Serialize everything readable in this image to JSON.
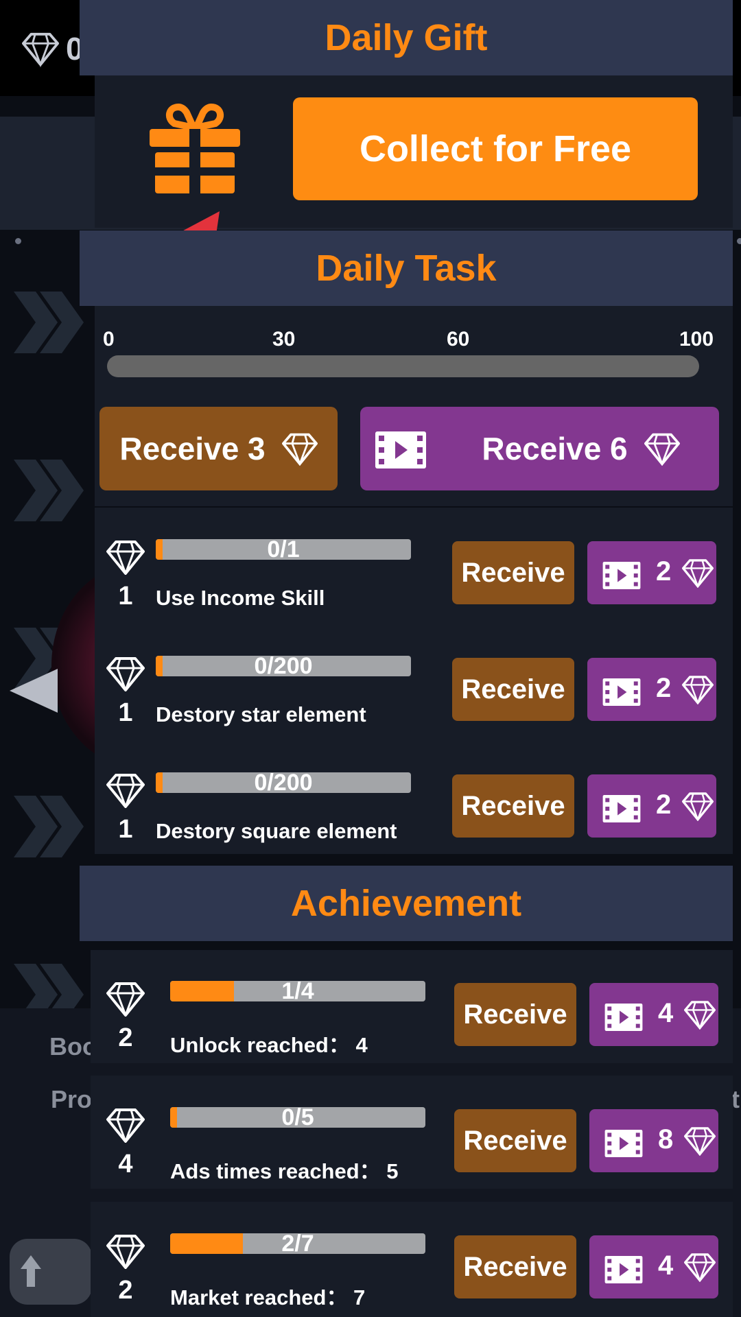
{
  "background": {
    "gem_count": "0",
    "label_1": "Boo",
    "label_2": "Pro",
    "label_3": "t"
  },
  "daily_gift": {
    "title": "Daily Gift",
    "collect_label": "Collect for Free"
  },
  "daily_task": {
    "title": "Daily Task",
    "progress_ticks": [
      "0",
      "30",
      "60",
      "100"
    ],
    "progress_value": 0,
    "receive_label": "Receive 3",
    "receive_ad_label": "Receive 6",
    "tasks": [
      {
        "reward": "1",
        "progress": "0/1",
        "fraction": 0,
        "label": "Use Income Skill",
        "receive": "Receive",
        "ad_reward": "2"
      },
      {
        "reward": "1",
        "progress": "0/200",
        "fraction": 0,
        "label": "Destory star element",
        "receive": "Receive",
        "ad_reward": "2"
      },
      {
        "reward": "1",
        "progress": "0/200",
        "fraction": 0,
        "label": "Destory square element",
        "receive": "Receive",
        "ad_reward": "2"
      }
    ]
  },
  "achievement": {
    "title": "Achievement",
    "items": [
      {
        "reward": "2",
        "progress": "1/4",
        "fraction": 0.25,
        "label": "Unlock reached： 4",
        "receive": "Receive",
        "ad_reward": "4"
      },
      {
        "reward": "4",
        "progress": "0/5",
        "fraction": 0,
        "label": "Ads times reached： 5",
        "receive": "Receive",
        "ad_reward": "8"
      },
      {
        "reward": "2",
        "progress": "2/7",
        "fraction": 0.2857,
        "label": "Market reached： 7",
        "receive": "Receive",
        "ad_reward": "4"
      }
    ]
  },
  "colors": {
    "accent_orange": "#ff8a14",
    "button_brown": "#8a521b",
    "button_purple": "#833790",
    "header_bg": "#2f3750",
    "panel_bg": "#171c27"
  },
  "icons": [
    "diamond-icon",
    "gift-icon",
    "video-ad-icon",
    "chevron-icon",
    "arrow-up-icon"
  ]
}
